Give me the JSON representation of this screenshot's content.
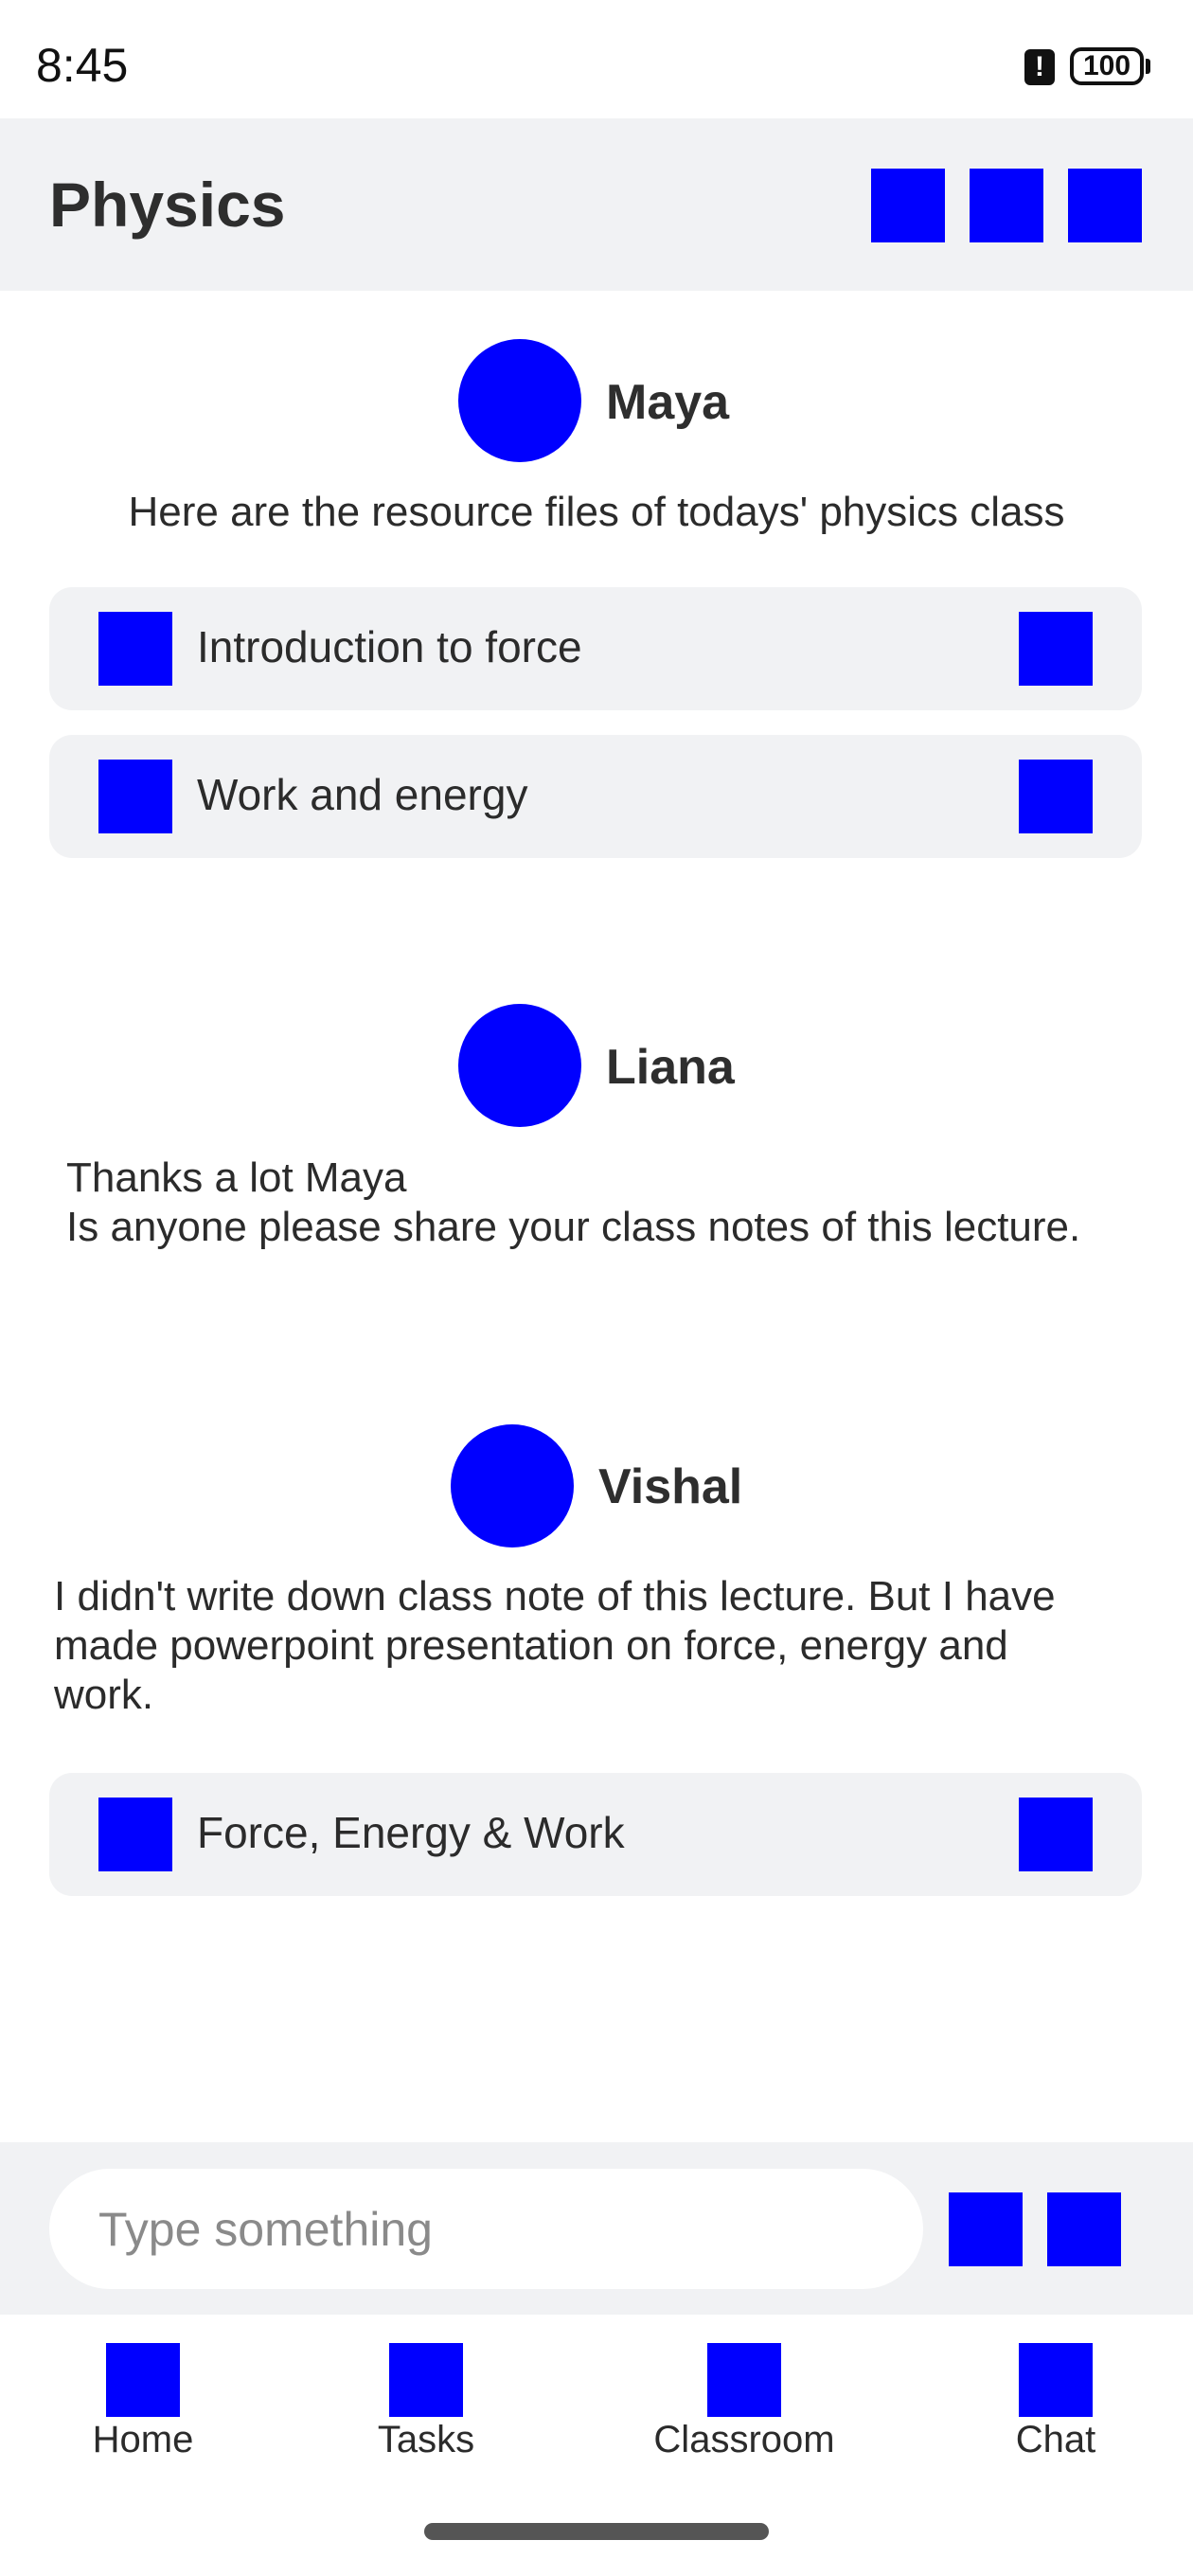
{
  "status_bar": {
    "time": "8:45",
    "alert_glyph": "!",
    "battery": "100"
  },
  "header": {
    "title": "Physics",
    "actions": [
      "action-icon",
      "action-icon",
      "action-icon"
    ]
  },
  "messages": [
    {
      "sender": "Maya",
      "text": "Here are the resource files of todays' physics class",
      "files": [
        {
          "name": "Introduction to force"
        },
        {
          "name": "Work and energy"
        }
      ]
    },
    {
      "sender": "Liana",
      "text_lines": [
        "Thanks a lot Maya",
        "Is anyone please share your class notes of this lecture."
      ]
    },
    {
      "sender": "Vishal",
      "text_lines": [
        "I didn't write down class note of this lecture. But I have",
        "made powerpoint presentation on force, energy and",
        "work."
      ],
      "files": [
        {
          "name": "Force, Energy & Work"
        }
      ]
    }
  ],
  "composer": {
    "placeholder": "Type something",
    "value": ""
  },
  "bottom_nav": [
    {
      "label": "Home"
    },
    {
      "label": "Tasks"
    },
    {
      "label": "Classroom"
    },
    {
      "label": "Chat"
    }
  ],
  "colors": {
    "accent": "#0000ff",
    "panel": "#f1f2f4",
    "text": "#2b2b2b"
  }
}
